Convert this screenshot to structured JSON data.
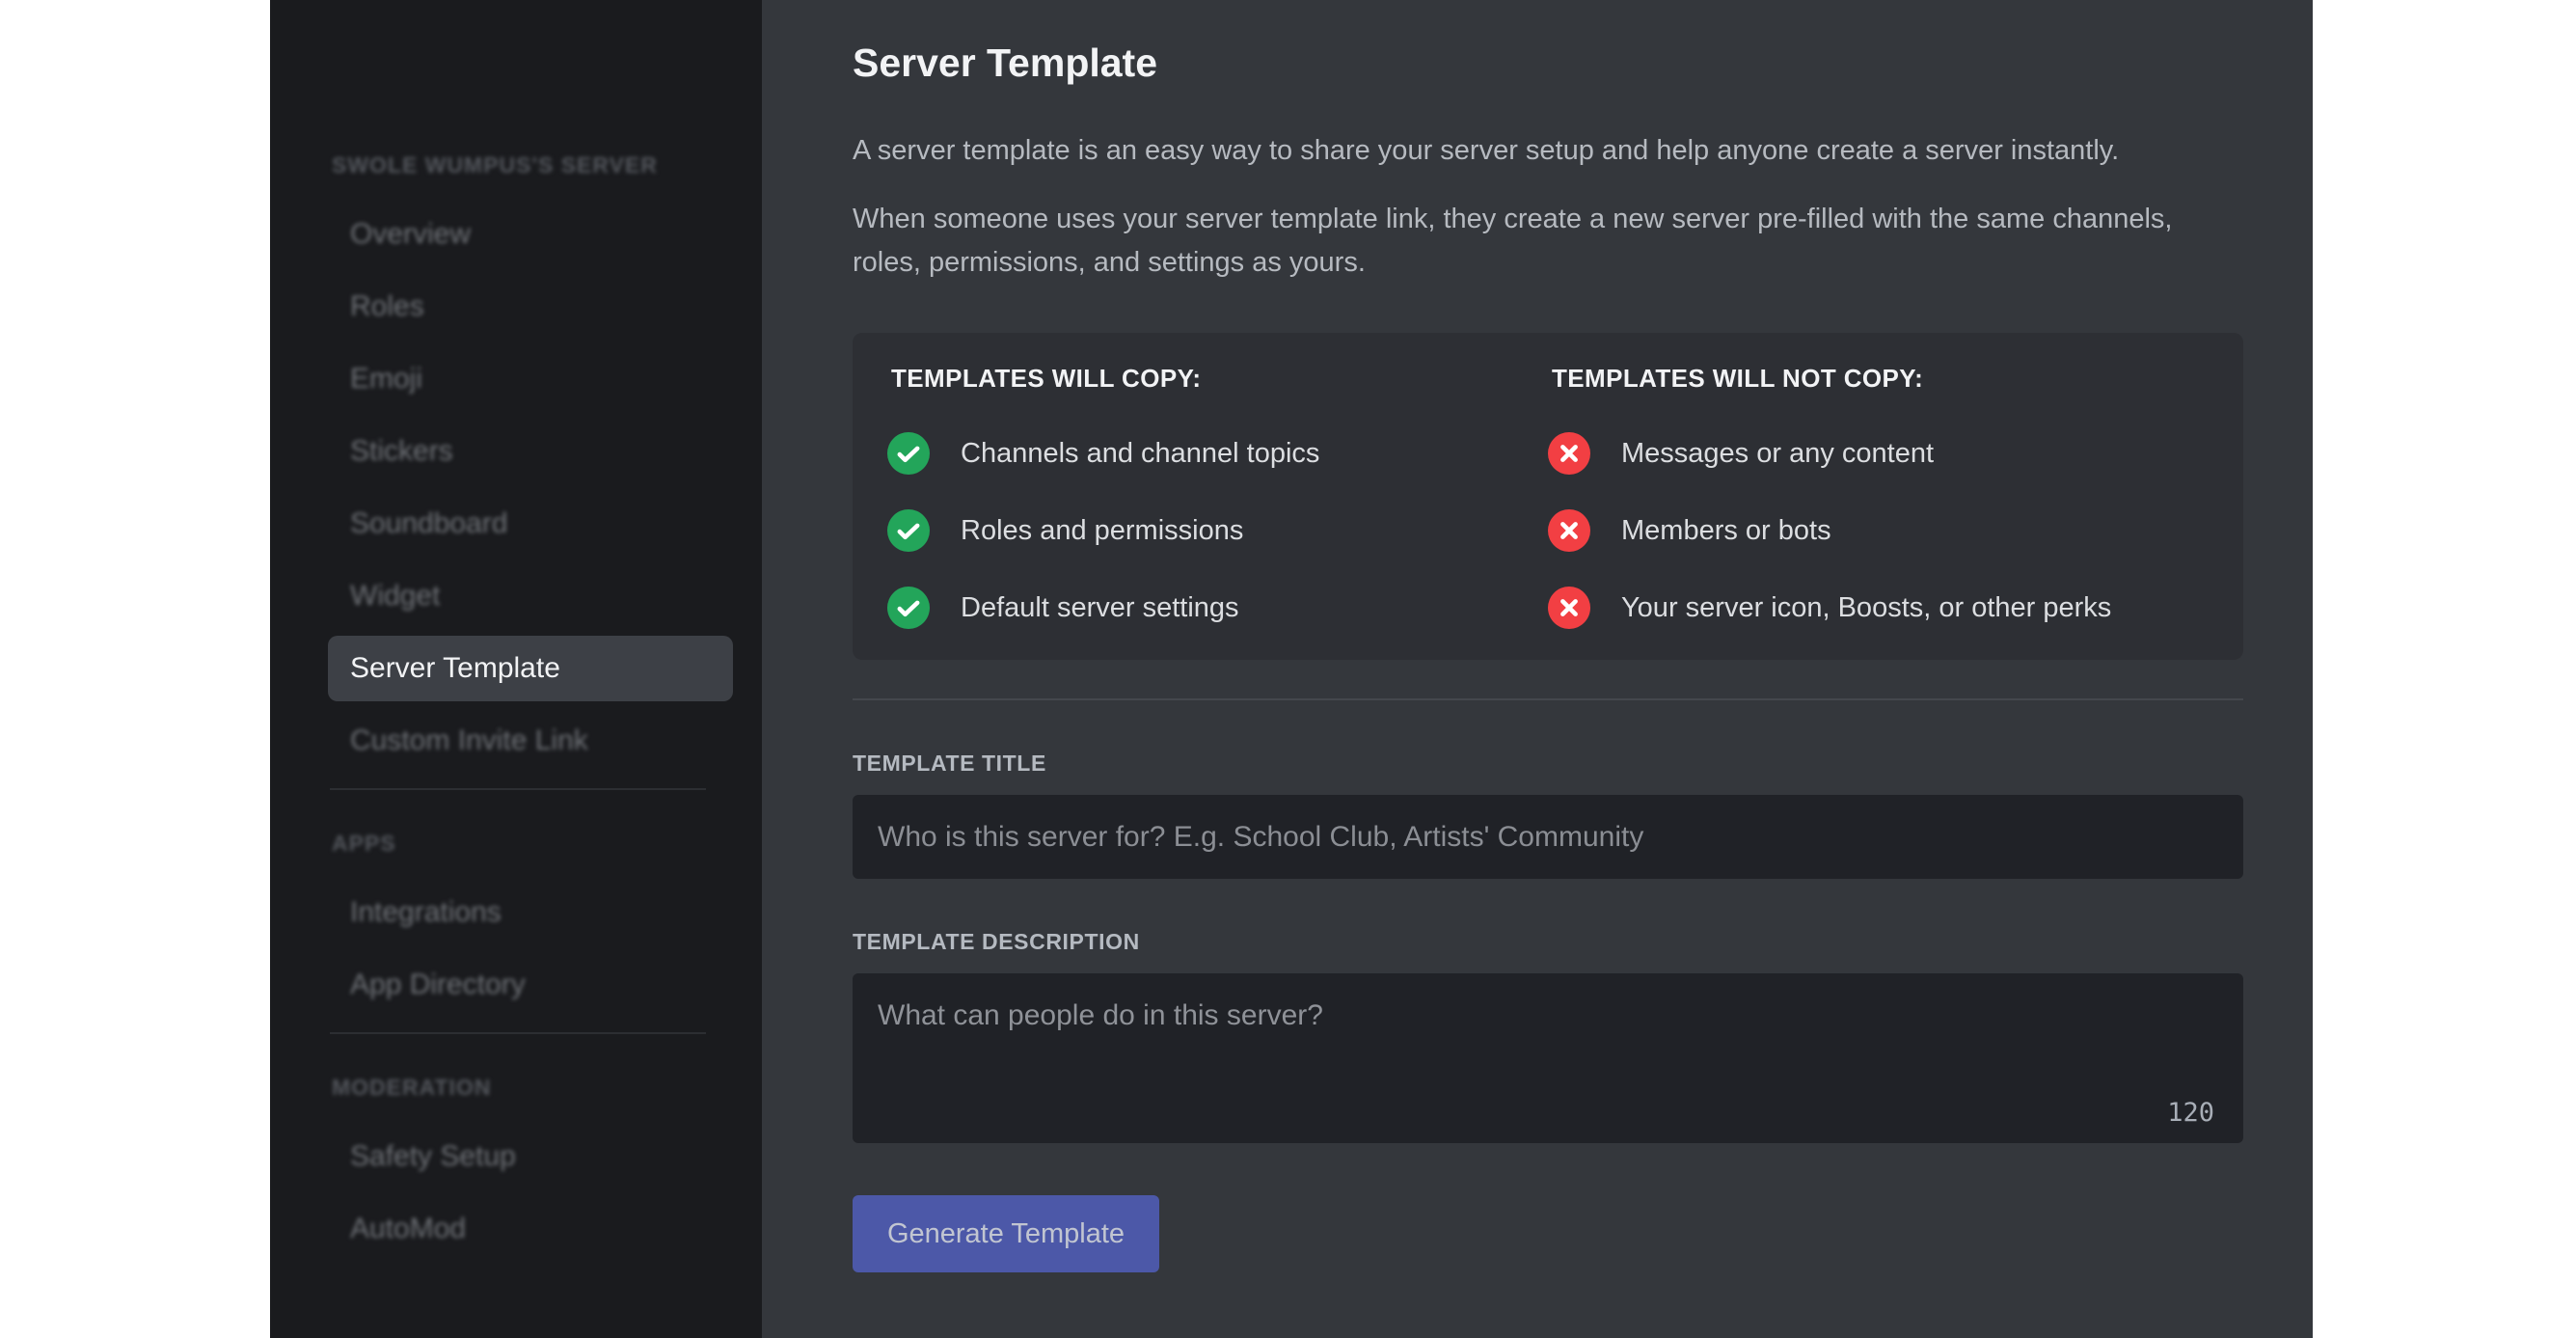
{
  "sidebar": {
    "groups": [
      {
        "header": "SWOLE WUMPUS'S SERVER",
        "items": [
          {
            "label": "Overview",
            "selected": false
          },
          {
            "label": "Roles",
            "selected": false
          },
          {
            "label": "Emoji",
            "selected": false
          },
          {
            "label": "Stickers",
            "selected": false
          },
          {
            "label": "Soundboard",
            "selected": false
          },
          {
            "label": "Widget",
            "selected": false
          },
          {
            "label": "Server Template",
            "selected": true
          },
          {
            "label": "Custom Invite Link",
            "selected": false
          }
        ]
      },
      {
        "header": "APPS",
        "items": [
          {
            "label": "Integrations",
            "selected": false
          },
          {
            "label": "App Directory",
            "selected": false
          }
        ]
      },
      {
        "header": "MODERATION",
        "items": [
          {
            "label": "Safety Setup",
            "selected": false
          },
          {
            "label": "AutoMod",
            "selected": false
          }
        ]
      }
    ]
  },
  "main": {
    "title": "Server Template",
    "intro": [
      "A server template is an easy way to share your server setup and help anyone create a server instantly.",
      "When someone uses your server template link, they create a new server pre-filled with the same channels, roles, permissions, and settings as yours."
    ],
    "copy_panel": {
      "will_copy": {
        "header": "TEMPLATES WILL COPY:",
        "icon": "check-icon",
        "items": [
          "Channels and channel topics",
          "Roles and permissions",
          "Default server settings"
        ]
      },
      "will_not_copy": {
        "header": "TEMPLATES WILL NOT COPY:",
        "icon": "x-icon",
        "items": [
          "Messages or any content",
          "Members or bots",
          "Your server icon, Boosts, or other perks"
        ]
      }
    },
    "form": {
      "title_label": "TEMPLATE TITLE",
      "title_value": "",
      "title_placeholder": "Who is this server for? E.g. School Club, Artists' Community",
      "description_label": "TEMPLATE DESCRIPTION",
      "description_value": "",
      "description_placeholder": "What can people do in this server?",
      "char_counter": "120",
      "generate_button_label": "Generate Template"
    }
  },
  "colors": {
    "accent_button": "#4c58a8",
    "success_green": "#23a55a",
    "error_red": "#f23f43",
    "selected_item_bg": "#3d4046",
    "main_background": "#34373c",
    "panel_background": "#2d2f34",
    "sidebar_background": "#1a1b1e",
    "input_background": "#202227"
  }
}
